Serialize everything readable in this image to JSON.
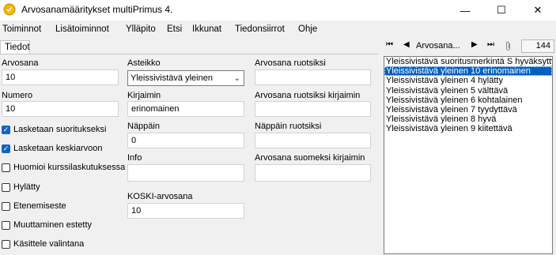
{
  "window": {
    "title": "Arvosanamääritykset multiPrimus 4.",
    "icon": "app-icon",
    "controls": {
      "minimize": "—",
      "maximize": "☐",
      "close": "✕"
    }
  },
  "menu": {
    "items": [
      "Toiminnot",
      "Lisätoiminnot",
      "Ylläpito",
      "Etsi",
      "Ikkunat",
      "Tiedonsiirrot",
      "Ohje"
    ]
  },
  "tabs": {
    "details": "Tiedot"
  },
  "form": {
    "grade_label": "Arvosana",
    "grade_value": "10",
    "number_label": "Numero",
    "number_value": "10",
    "scale_label": "Asteikko",
    "scale_value": "Yleissivistävä yleinen",
    "letters_label": "Kirjaimin",
    "letters_value": "erinomainen",
    "key_label": "Näppäin",
    "key_value": "0",
    "info_label": "Info",
    "info_value": "",
    "koski_label": "KOSKI-arvosana",
    "koski_value": "10",
    "swedish_grade_label": "Arvosana ruotsiksi",
    "swedish_grade_value": "",
    "swedish_letters_label": "Arvosana ruotsiksi kirjaimin",
    "swedish_letters_value": "",
    "swedish_key_label": "Näppäin ruotsiksi",
    "swedish_key_value": "",
    "finnish_letters_label": "Arvosana suomeksi kirjaimin",
    "finnish_letters_value": ""
  },
  "checkboxes": [
    {
      "label": "Lasketaan suoritukseksi",
      "checked": true
    },
    {
      "label": "Lasketaan keskiarvoon",
      "checked": true
    },
    {
      "label": "Huomioi kurssilaskutuksessa",
      "checked": false
    },
    {
      "label": "Hylätty",
      "checked": false
    },
    {
      "label": "Etenemiseste",
      "checked": false
    },
    {
      "label": "Muuttaminen estetty",
      "checked": false
    },
    {
      "label": "Käsittele valintana",
      "checked": false
    }
  ],
  "navigator": {
    "first": "⏮",
    "prev": "◀",
    "label": "Arvosana...",
    "next": "▶",
    "last": "⏭",
    "attach_icon": "paperclip-icon",
    "count": "144"
  },
  "list": {
    "items": [
      "Yleissivistävä suoritusmerkintä S hyväksytty",
      "Yleissivistävä yleinen 10 erinomainen",
      "Yleissivistävä yleinen 4 hylätty",
      "Yleissivistävä yleinen 5 välttävä",
      "Yleissivistävä yleinen 6 kohtalainen",
      "Yleissivistävä yleinen 7 tyydyttävä",
      "Yleissivistävä yleinen 8 hyvä",
      "Yleissivistävä yleinen 9 kiitettävä"
    ],
    "selected_index": 1
  },
  "colors": {
    "selection": "#0060c0",
    "checkbox_checked": "#1565c0",
    "app_icon": "#f5b800"
  }
}
